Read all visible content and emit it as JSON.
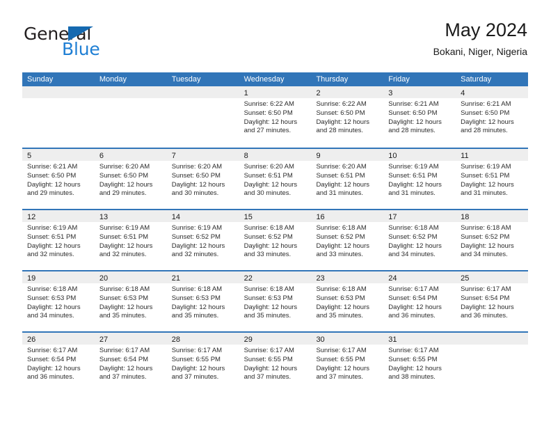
{
  "logo": {
    "primary_text": "General",
    "secondary_text": "Blue",
    "triangle_icon": "blue-triangle-icon",
    "primary_color": "#231f20",
    "secondary_color": "#1f7fd4"
  },
  "header": {
    "title": "May 2024",
    "subtitle": "Bokani, Niger, Nigeria"
  },
  "theme": {
    "header_blue": "#3175b8",
    "day_band_gray": "#eeeeee",
    "text_color": "#1a1a1a"
  },
  "weekdays": [
    "Sunday",
    "Monday",
    "Tuesday",
    "Wednesday",
    "Thursday",
    "Friday",
    "Saturday"
  ],
  "weeks": [
    [
      {
        "day": "",
        "empty": true,
        "sunrise": "",
        "sunset": "",
        "daylight_1": "",
        "daylight_2": ""
      },
      {
        "day": "",
        "empty": true,
        "sunrise": "",
        "sunset": "",
        "daylight_1": "",
        "daylight_2": ""
      },
      {
        "day": "",
        "empty": true,
        "sunrise": "",
        "sunset": "",
        "daylight_1": "",
        "daylight_2": ""
      },
      {
        "day": "1",
        "empty": false,
        "sunrise": "Sunrise: 6:22 AM",
        "sunset": "Sunset: 6:50 PM",
        "daylight_1": "Daylight: 12 hours",
        "daylight_2": "and 27 minutes."
      },
      {
        "day": "2",
        "empty": false,
        "sunrise": "Sunrise: 6:22 AM",
        "sunset": "Sunset: 6:50 PM",
        "daylight_1": "Daylight: 12 hours",
        "daylight_2": "and 28 minutes."
      },
      {
        "day": "3",
        "empty": false,
        "sunrise": "Sunrise: 6:21 AM",
        "sunset": "Sunset: 6:50 PM",
        "daylight_1": "Daylight: 12 hours",
        "daylight_2": "and 28 minutes."
      },
      {
        "day": "4",
        "empty": false,
        "sunrise": "Sunrise: 6:21 AM",
        "sunset": "Sunset: 6:50 PM",
        "daylight_1": "Daylight: 12 hours",
        "daylight_2": "and 28 minutes."
      }
    ],
    [
      {
        "day": "5",
        "empty": false,
        "sunrise": "Sunrise: 6:21 AM",
        "sunset": "Sunset: 6:50 PM",
        "daylight_1": "Daylight: 12 hours",
        "daylight_2": "and 29 minutes."
      },
      {
        "day": "6",
        "empty": false,
        "sunrise": "Sunrise: 6:20 AM",
        "sunset": "Sunset: 6:50 PM",
        "daylight_1": "Daylight: 12 hours",
        "daylight_2": "and 29 minutes."
      },
      {
        "day": "7",
        "empty": false,
        "sunrise": "Sunrise: 6:20 AM",
        "sunset": "Sunset: 6:50 PM",
        "daylight_1": "Daylight: 12 hours",
        "daylight_2": "and 30 minutes."
      },
      {
        "day": "8",
        "empty": false,
        "sunrise": "Sunrise: 6:20 AM",
        "sunset": "Sunset: 6:51 PM",
        "daylight_1": "Daylight: 12 hours",
        "daylight_2": "and 30 minutes."
      },
      {
        "day": "9",
        "empty": false,
        "sunrise": "Sunrise: 6:20 AM",
        "sunset": "Sunset: 6:51 PM",
        "daylight_1": "Daylight: 12 hours",
        "daylight_2": "and 31 minutes."
      },
      {
        "day": "10",
        "empty": false,
        "sunrise": "Sunrise: 6:19 AM",
        "sunset": "Sunset: 6:51 PM",
        "daylight_1": "Daylight: 12 hours",
        "daylight_2": "and 31 minutes."
      },
      {
        "day": "11",
        "empty": false,
        "sunrise": "Sunrise: 6:19 AM",
        "sunset": "Sunset: 6:51 PM",
        "daylight_1": "Daylight: 12 hours",
        "daylight_2": "and 31 minutes."
      }
    ],
    [
      {
        "day": "12",
        "empty": false,
        "sunrise": "Sunrise: 6:19 AM",
        "sunset": "Sunset: 6:51 PM",
        "daylight_1": "Daylight: 12 hours",
        "daylight_2": "and 32 minutes."
      },
      {
        "day": "13",
        "empty": false,
        "sunrise": "Sunrise: 6:19 AM",
        "sunset": "Sunset: 6:51 PM",
        "daylight_1": "Daylight: 12 hours",
        "daylight_2": "and 32 minutes."
      },
      {
        "day": "14",
        "empty": false,
        "sunrise": "Sunrise: 6:19 AM",
        "sunset": "Sunset: 6:52 PM",
        "daylight_1": "Daylight: 12 hours",
        "daylight_2": "and 32 minutes."
      },
      {
        "day": "15",
        "empty": false,
        "sunrise": "Sunrise: 6:18 AM",
        "sunset": "Sunset: 6:52 PM",
        "daylight_1": "Daylight: 12 hours",
        "daylight_2": "and 33 minutes."
      },
      {
        "day": "16",
        "empty": false,
        "sunrise": "Sunrise: 6:18 AM",
        "sunset": "Sunset: 6:52 PM",
        "daylight_1": "Daylight: 12 hours",
        "daylight_2": "and 33 minutes."
      },
      {
        "day": "17",
        "empty": false,
        "sunrise": "Sunrise: 6:18 AM",
        "sunset": "Sunset: 6:52 PM",
        "daylight_1": "Daylight: 12 hours",
        "daylight_2": "and 34 minutes."
      },
      {
        "day": "18",
        "empty": false,
        "sunrise": "Sunrise: 6:18 AM",
        "sunset": "Sunset: 6:52 PM",
        "daylight_1": "Daylight: 12 hours",
        "daylight_2": "and 34 minutes."
      }
    ],
    [
      {
        "day": "19",
        "empty": false,
        "sunrise": "Sunrise: 6:18 AM",
        "sunset": "Sunset: 6:53 PM",
        "daylight_1": "Daylight: 12 hours",
        "daylight_2": "and 34 minutes."
      },
      {
        "day": "20",
        "empty": false,
        "sunrise": "Sunrise: 6:18 AM",
        "sunset": "Sunset: 6:53 PM",
        "daylight_1": "Daylight: 12 hours",
        "daylight_2": "and 35 minutes."
      },
      {
        "day": "21",
        "empty": false,
        "sunrise": "Sunrise: 6:18 AM",
        "sunset": "Sunset: 6:53 PM",
        "daylight_1": "Daylight: 12 hours",
        "daylight_2": "and 35 minutes."
      },
      {
        "day": "22",
        "empty": false,
        "sunrise": "Sunrise: 6:18 AM",
        "sunset": "Sunset: 6:53 PM",
        "daylight_1": "Daylight: 12 hours",
        "daylight_2": "and 35 minutes."
      },
      {
        "day": "23",
        "empty": false,
        "sunrise": "Sunrise: 6:18 AM",
        "sunset": "Sunset: 6:53 PM",
        "daylight_1": "Daylight: 12 hours",
        "daylight_2": "and 35 minutes."
      },
      {
        "day": "24",
        "empty": false,
        "sunrise": "Sunrise: 6:17 AM",
        "sunset": "Sunset: 6:54 PM",
        "daylight_1": "Daylight: 12 hours",
        "daylight_2": "and 36 minutes."
      },
      {
        "day": "25",
        "empty": false,
        "sunrise": "Sunrise: 6:17 AM",
        "sunset": "Sunset: 6:54 PM",
        "daylight_1": "Daylight: 12 hours",
        "daylight_2": "and 36 minutes."
      }
    ],
    [
      {
        "day": "26",
        "empty": false,
        "sunrise": "Sunrise: 6:17 AM",
        "sunset": "Sunset: 6:54 PM",
        "daylight_1": "Daylight: 12 hours",
        "daylight_2": "and 36 minutes."
      },
      {
        "day": "27",
        "empty": false,
        "sunrise": "Sunrise: 6:17 AM",
        "sunset": "Sunset: 6:54 PM",
        "daylight_1": "Daylight: 12 hours",
        "daylight_2": "and 37 minutes."
      },
      {
        "day": "28",
        "empty": false,
        "sunrise": "Sunrise: 6:17 AM",
        "sunset": "Sunset: 6:55 PM",
        "daylight_1": "Daylight: 12 hours",
        "daylight_2": "and 37 minutes."
      },
      {
        "day": "29",
        "empty": false,
        "sunrise": "Sunrise: 6:17 AM",
        "sunset": "Sunset: 6:55 PM",
        "daylight_1": "Daylight: 12 hours",
        "daylight_2": "and 37 minutes."
      },
      {
        "day": "30",
        "empty": false,
        "sunrise": "Sunrise: 6:17 AM",
        "sunset": "Sunset: 6:55 PM",
        "daylight_1": "Daylight: 12 hours",
        "daylight_2": "and 37 minutes."
      },
      {
        "day": "31",
        "empty": false,
        "sunrise": "Sunrise: 6:17 AM",
        "sunset": "Sunset: 6:55 PM",
        "daylight_1": "Daylight: 12 hours",
        "daylight_2": "and 38 minutes."
      },
      {
        "day": "",
        "empty": true,
        "sunrise": "",
        "sunset": "",
        "daylight_1": "",
        "daylight_2": ""
      }
    ]
  ]
}
